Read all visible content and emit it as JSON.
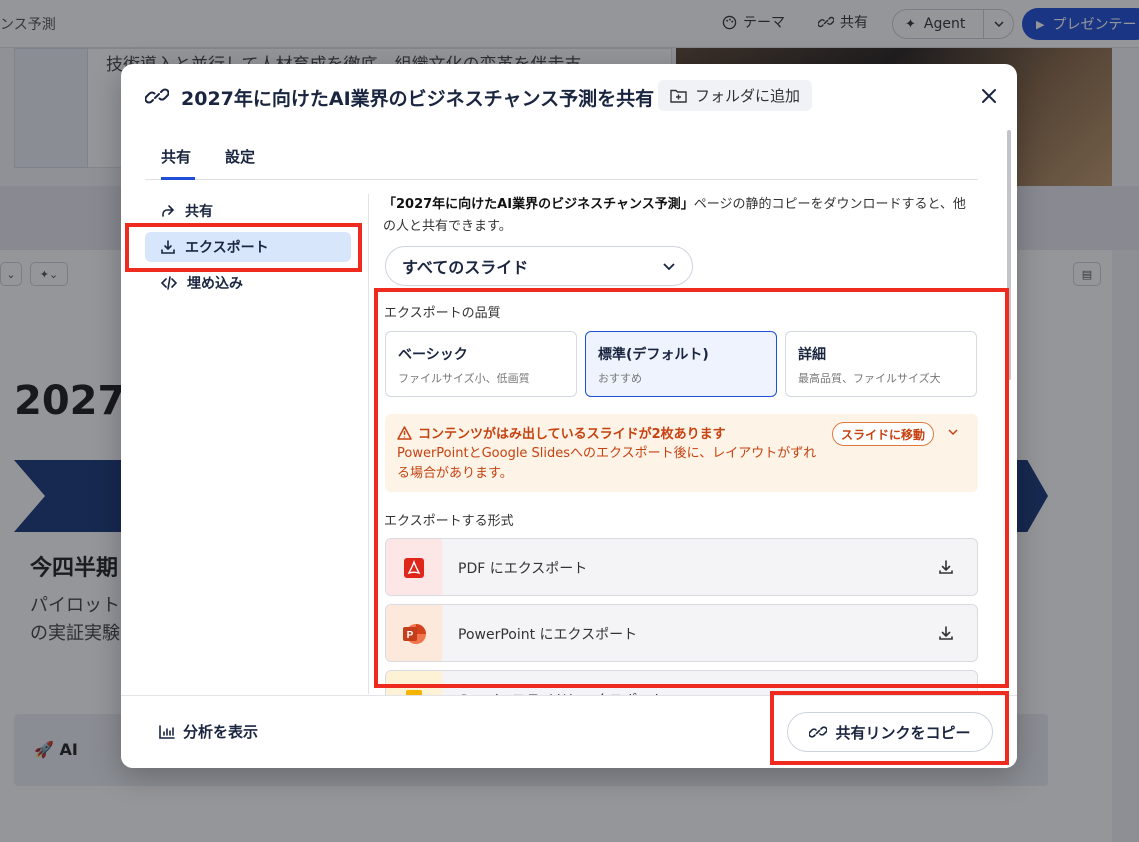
{
  "app": {
    "doc_title_partial": "ンス予測",
    "theme_label": "テーマ",
    "share_label": "共有",
    "agent_label": "Agent",
    "present_label": "プレゼンテー"
  },
  "background": {
    "card_text": "技術導入と並行して人材育成を徹底。組織文化の変革を伴走支",
    "heading": "2027",
    "subheading": "今四半期",
    "para_line1": "パイロット",
    "para_line2": "の実証実験",
    "note_text": "🚀 AI"
  },
  "modal": {
    "title": "2027年に向けたAI業界のビジネスチャンス予測を共有",
    "folder_label": "フォルダに追加",
    "tabs": [
      {
        "label": "共有"
      },
      {
        "label": "設定"
      }
    ],
    "side": [
      {
        "label": "共有"
      },
      {
        "label": "エクスポート"
      },
      {
        "label": "埋め込み"
      }
    ],
    "desc_doc": "「2027年に向けたAI業界のビジネスチャンス予測」",
    "desc_rest": "ページの静的コピーをダウンロードすると、他の人と共有できます。",
    "select_value": "すべてのスライド",
    "quality_label": "エクスポートの品質",
    "quality_options": [
      {
        "title": "ベーシック",
        "sub": "ファイルサイズ小、低画質"
      },
      {
        "title": "標準(デフォルト)",
        "sub": "おすすめ"
      },
      {
        "title": "詳細",
        "sub": "最高品質、ファイルサイズ大"
      }
    ],
    "warning_title": "コンテンツがはみ出しているスライドが2枚あります",
    "warning_body": "PowerPointとGoogle Slidesへのエクスポート後に、レイアウトがずれる場合があります。",
    "warning_button": "スライドに移動",
    "format_label": "エクスポートする形式",
    "formats": [
      {
        "label": "PDF にエクスポート",
        "icon": "pdf-icon"
      },
      {
        "label": "PowerPoint にエクスポート",
        "icon": "powerpoint-icon"
      },
      {
        "label": "Google スライドにエクスポート",
        "icon": "google-slides-icon"
      }
    ],
    "footer_analytics": "分析を表示",
    "footer_copy": "共有リンクをコピー"
  },
  "colors": {
    "accent": "#1f4fd8",
    "highlight": "#ef2a1f",
    "warning": "#c64210",
    "selected_bg": "#d8e6fb"
  }
}
